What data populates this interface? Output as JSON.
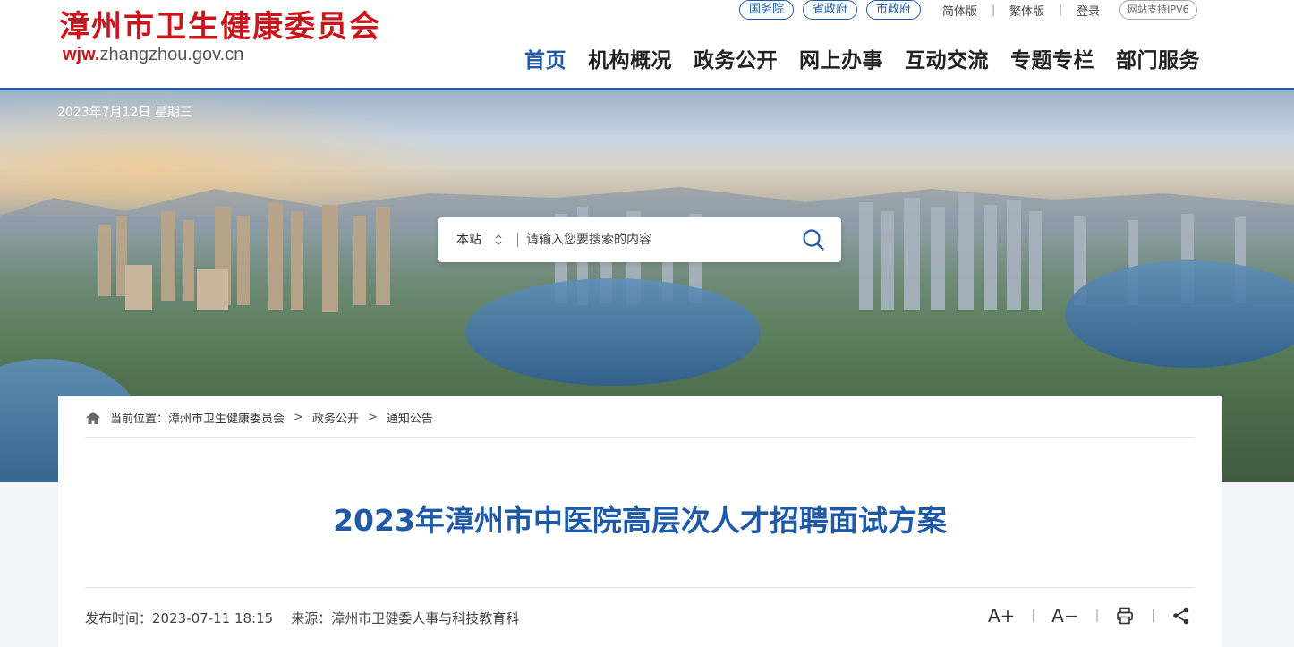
{
  "site": {
    "title": "漳州市卫生健康委员会",
    "url_prefix": "wjw.",
    "url_rest": "zhangzhou.gov.cn"
  },
  "topbar": {
    "pills": [
      "国务院",
      "省政府",
      "市政府"
    ],
    "links": [
      "简体版",
      "繁体版",
      "登录"
    ],
    "ipv6": "网站支持IPV6"
  },
  "nav": {
    "items": [
      "首页",
      "机构概况",
      "政务公开",
      "网上办事",
      "互动交流",
      "专题专栏",
      "部门服务"
    ],
    "active_index": 0
  },
  "banner": {
    "date": "2023年7月12日 星期三"
  },
  "search": {
    "scope": "本站",
    "placeholder": "请输入您要搜索的内容"
  },
  "breadcrumb": {
    "prefix": "当前位置：",
    "items": [
      "漳州市卫生健康委员会",
      "政务公开",
      "通知公告"
    ],
    "separator": ">"
  },
  "article": {
    "title": "2023年漳州市中医院高层次人才招聘面试方案",
    "publish_label": "发布时间：",
    "publish_time": "2023-07-11 18:15",
    "source_label": "来源：",
    "source": "漳州市卫健委人事与科技教育科"
  },
  "tools": {
    "font_increase": "A+",
    "font_decrease": "A−",
    "separator": "|"
  },
  "colors": {
    "brand_red": "#c8161d",
    "brand_blue": "#1f5aa6"
  }
}
